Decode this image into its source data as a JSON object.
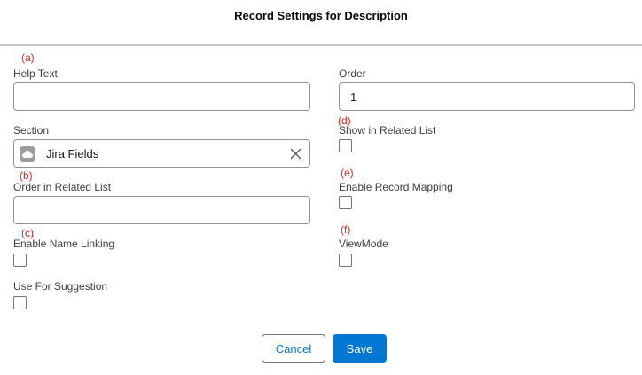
{
  "modal": {
    "title": "Record Settings for Description"
  },
  "annotations": {
    "a": "(a)",
    "b": "(b)",
    "c": "(c)",
    "d": "(d)",
    "e": "(e)",
    "f": "(f)"
  },
  "fields": {
    "help_text": {
      "label": "Help Text",
      "value": ""
    },
    "order": {
      "label": "Order",
      "value": "1"
    },
    "section": {
      "label": "Section",
      "value": "Jira Fields",
      "icon": "record-icon"
    },
    "show_in_related_list": {
      "label": "Show in Related List",
      "checked": false
    },
    "order_in_related_list": {
      "label": "Order in Related List",
      "value": ""
    },
    "enable_record_mapping": {
      "label": "Enable Record Mapping",
      "checked": false
    },
    "enable_name_linking": {
      "label": "Enable Name Linking",
      "checked": false
    },
    "view_mode": {
      "label": "ViewMode",
      "checked": false
    },
    "use_for_suggestion": {
      "label": "Use For Suggestion",
      "checked": false
    }
  },
  "buttons": {
    "cancel": "Cancel",
    "save": "Save"
  },
  "colors": {
    "brand": "#0176d3",
    "annotation": "#e0261c",
    "border": "#939393"
  }
}
